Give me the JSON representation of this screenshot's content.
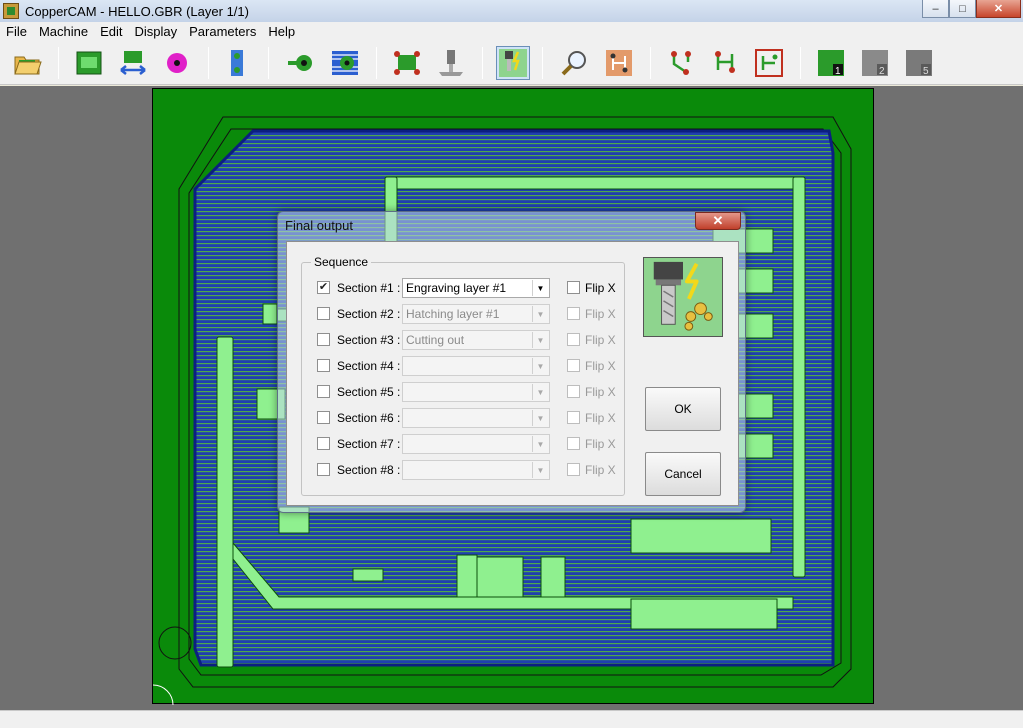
{
  "window": {
    "title": "CopperCAM  -  HELLO.GBR  (Layer 1/1)",
    "minimize": "–",
    "maximize": "□",
    "close": "✕"
  },
  "menu": [
    "File",
    "Machine",
    "Edit",
    "Display",
    "Parameters",
    "Help"
  ],
  "toolbar": {
    "icons": [
      "open-folder-icon",
      "board-icon",
      "swap-icon",
      "drill-hole-icon",
      "pads-icon",
      "pad-add-icon",
      "pad-hatch-icon",
      "board-outline-icon",
      "mill-tool-icon",
      "engrave-output-icon",
      "zoom-icon",
      "board-view-icon",
      "tracks-icon",
      "tracks-alt-icon",
      "tracks-frame-icon",
      "layer-1-icon",
      "layer-2-icon",
      "layer-5-icon"
    ],
    "layer_labels": [
      "1",
      "2",
      "5"
    ],
    "active": "engrave-output-icon"
  },
  "dialog": {
    "title": "Final output",
    "close_label": "✕",
    "group_title": "Sequence",
    "ok_label": "OK",
    "cancel_label": "Cancel",
    "sections": [
      {
        "label": "Section #1 :",
        "value": "Engraving layer #1",
        "checked": true,
        "enabled": true,
        "flip": "Flip X"
      },
      {
        "label": "Section #2 :",
        "value": "Hatching layer #1",
        "checked": false,
        "enabled": false,
        "flip": "Flip X"
      },
      {
        "label": "Section #3 :",
        "value": "Cutting out",
        "checked": false,
        "enabled": false,
        "flip": "Flip X"
      },
      {
        "label": "Section #4 :",
        "value": "",
        "checked": false,
        "enabled": false,
        "flip": "Flip X"
      },
      {
        "label": "Section #5 :",
        "value": "",
        "checked": false,
        "enabled": false,
        "flip": "Flip X"
      },
      {
        "label": "Section #6 :",
        "value": "",
        "checked": false,
        "enabled": false,
        "flip": "Flip X"
      },
      {
        "label": "Section #7 :",
        "value": "",
        "checked": false,
        "enabled": false,
        "flip": "Flip X"
      },
      {
        "label": "Section #8 :",
        "value": "",
        "checked": false,
        "enabled": false,
        "flip": "Flip X"
      }
    ]
  },
  "colors": {
    "board": "#0a8a0a",
    "hatch": "#1f3fb0",
    "track": "#8ff08f"
  }
}
